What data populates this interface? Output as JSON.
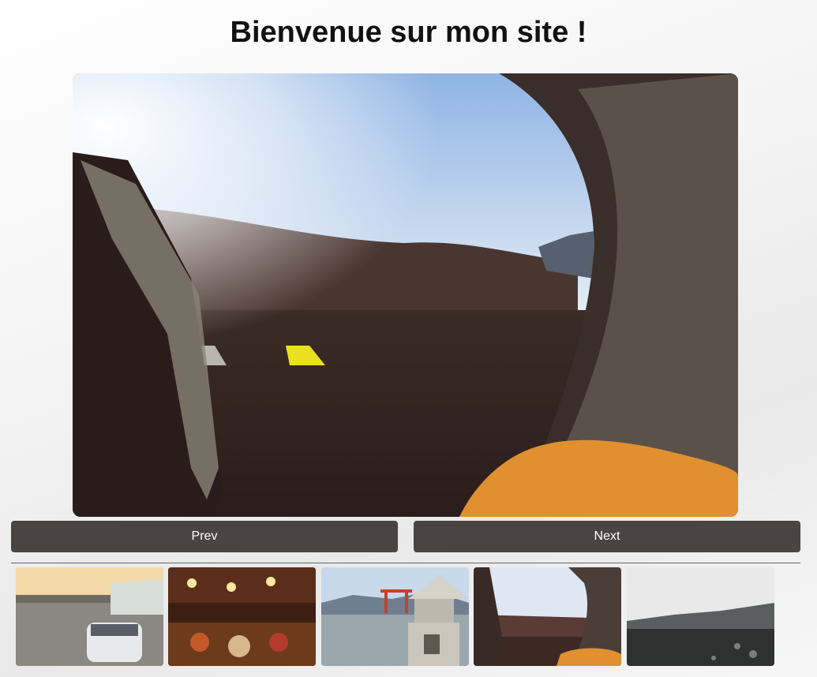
{
  "page": {
    "title": "Bienvenue sur mon site !"
  },
  "gallery": {
    "main_image_icon": "tent-view-photo",
    "prev_label": "Prev",
    "next_label": "Next",
    "thumbnails": [
      {
        "icon": "street-sunset-photo"
      },
      {
        "icon": "market-lights-photo"
      },
      {
        "icon": "torii-lantern-photo"
      },
      {
        "icon": "tent-view-photo"
      },
      {
        "icon": "foggy-field-photo"
      }
    ]
  },
  "colors": {
    "button_bg": "#4a4543",
    "button_text": "#ffffff"
  }
}
